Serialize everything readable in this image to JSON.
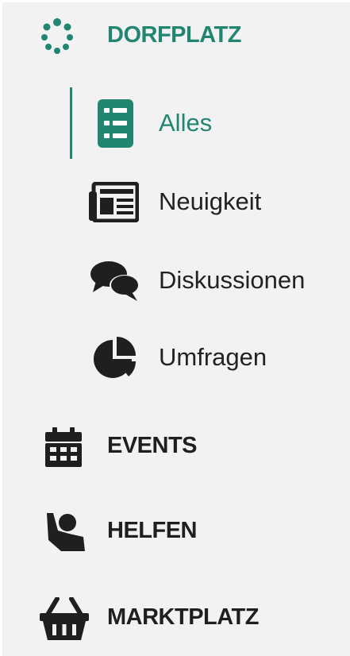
{
  "nav": {
    "dorfplatz": {
      "label": "DORFPLATZ",
      "icon": "dots-ring-icon"
    },
    "sub": [
      {
        "label": "Alles",
        "icon": "list-icon",
        "active": true
      },
      {
        "label": "Neuigkeit",
        "icon": "newspaper-icon"
      },
      {
        "label": "Diskussionen",
        "icon": "chat-bubbles-icon"
      },
      {
        "label": "Umfragen",
        "icon": "pie-chart-icon"
      }
    ],
    "events": {
      "label": "EVENTS",
      "icon": "calendar-icon"
    },
    "helfen": {
      "label": "HELFEN",
      "icon": "helping-person-icon"
    },
    "marktplatz": {
      "label": "MARKTPLATZ",
      "icon": "basket-icon"
    }
  },
  "colors": {
    "accent": "#218572",
    "text": "#1f1f1f",
    "background": "#f2f2f2"
  }
}
